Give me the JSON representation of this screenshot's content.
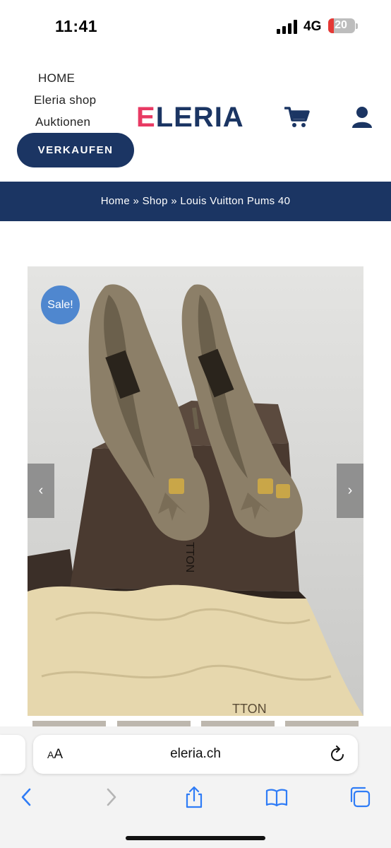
{
  "status_bar": {
    "time": "11:41",
    "network": "4G",
    "battery": "20"
  },
  "header": {
    "nav": [
      "HOME",
      "Eleria shop",
      "Auktionen"
    ],
    "sell_button": "VERKAUFEN",
    "logo_first": "E",
    "logo_rest": "LERIA",
    "icons": [
      "cart-icon",
      "user-icon"
    ]
  },
  "breadcrumb": {
    "text": "Home » Shop » Louis Vuitton Pums 40"
  },
  "product": {
    "sale_badge": "Sale!",
    "prev_arrow": "‹",
    "next_arrow": "›",
    "box_text": "TTON",
    "bag_text": "TTON"
  },
  "browser": {
    "aa_small": "A",
    "aa_large": "A",
    "url": "eleria.ch",
    "toolbar_icons": [
      "back-icon",
      "forward-icon",
      "share-icon",
      "bookmarks-icon",
      "tabs-icon"
    ]
  },
  "colors": {
    "brand_navy": "#1b3563",
    "brand_pink": "#e83a63",
    "sale_blue": "#4f87cf"
  }
}
